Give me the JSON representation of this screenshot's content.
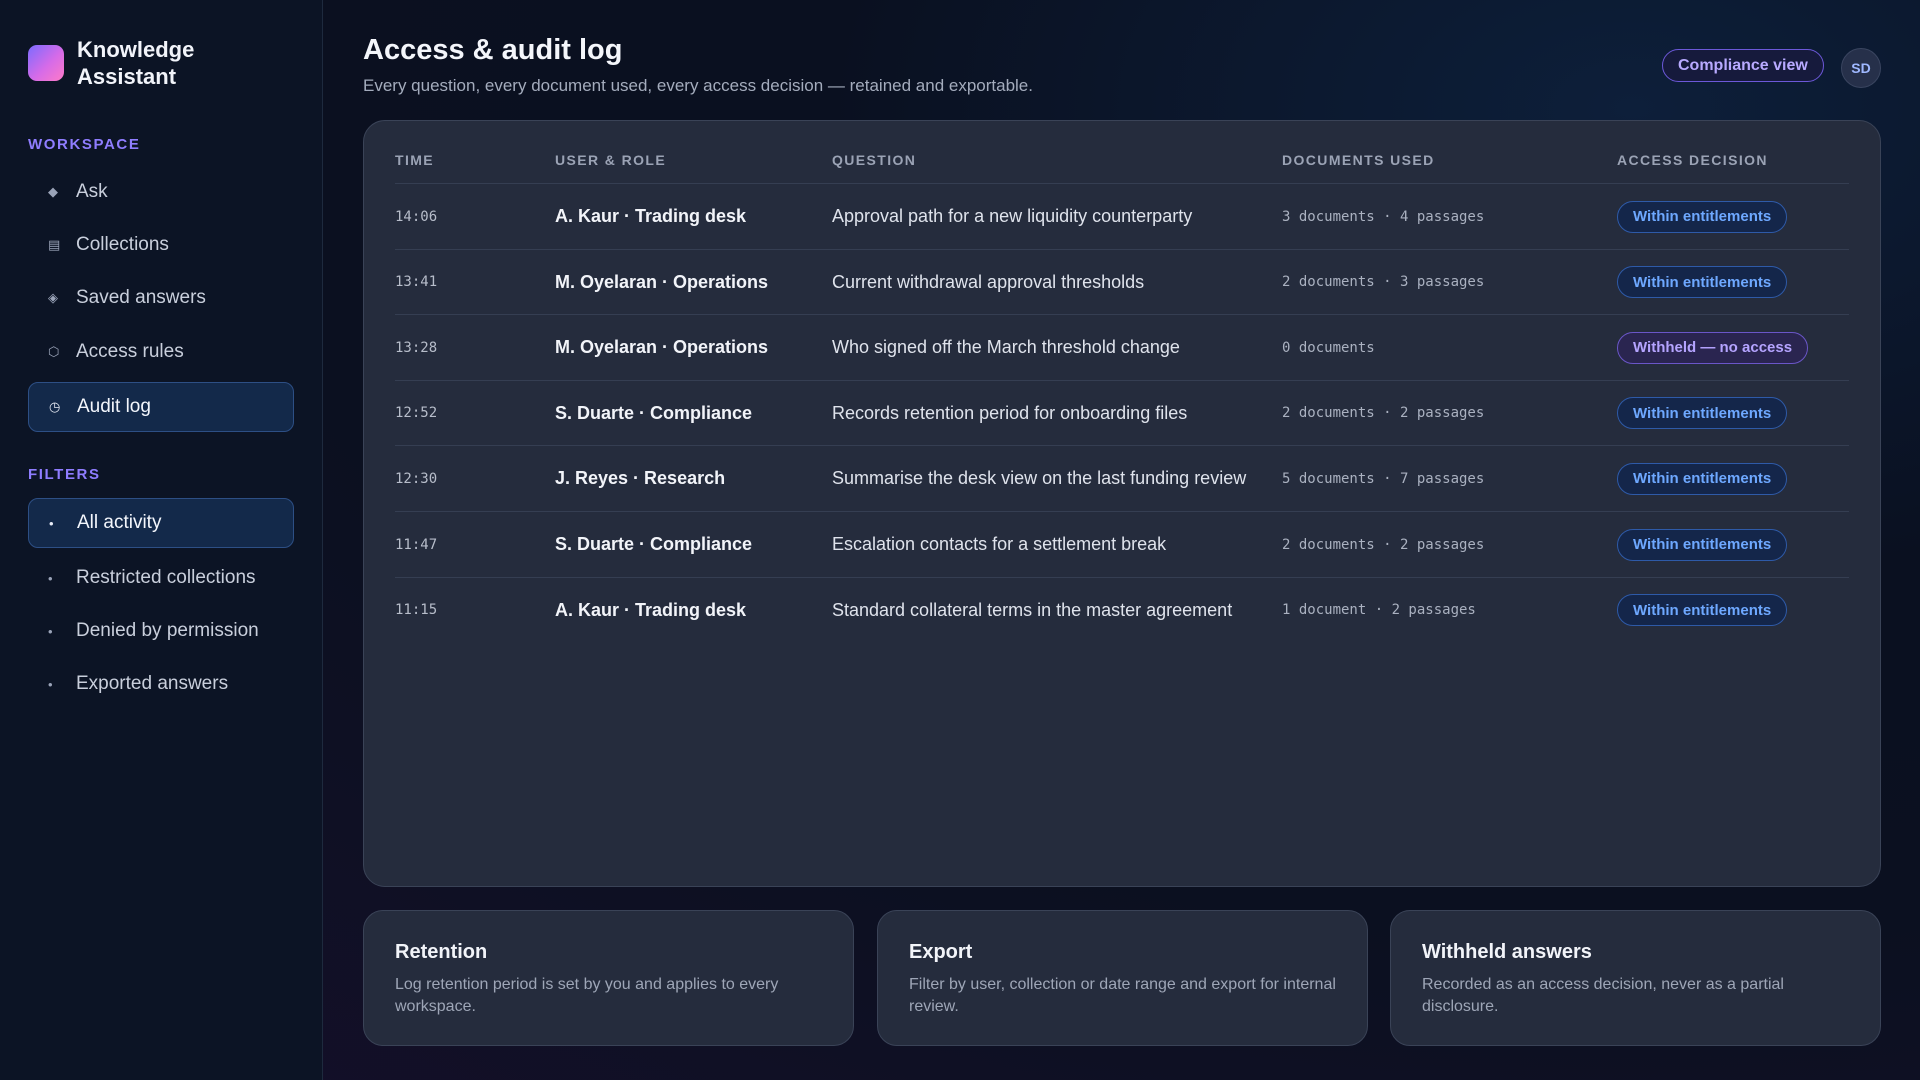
{
  "app": {
    "name": "Knowledge Assistant"
  },
  "sidebar": {
    "workspace_label": "WORKSPACE",
    "items": [
      {
        "label": "Ask",
        "icon": "diamond-icon"
      },
      {
        "label": "Collections",
        "icon": "list-icon"
      },
      {
        "label": "Saved answers",
        "icon": "bookmark-diamond-icon"
      },
      {
        "label": "Access rules",
        "icon": "shield-hexagon-icon"
      },
      {
        "label": "Audit log",
        "icon": "clock-icon",
        "active": true
      }
    ],
    "filters_label": "FILTERS",
    "filters": [
      {
        "label": "All activity",
        "active": true
      },
      {
        "label": "Restricted collections"
      },
      {
        "label": "Denied by permission"
      },
      {
        "label": "Exported answers"
      }
    ]
  },
  "header": {
    "title": "Access & audit log",
    "subtitle": "Every question, every document used, every access decision — retained and exportable.",
    "compliance_button": "Compliance view",
    "avatar_initials": "SD"
  },
  "table": {
    "columns": [
      "TIME",
      "USER & ROLE",
      "QUESTION",
      "DOCUMENTS USED",
      "ACCESS DECISION"
    ],
    "rows": [
      {
        "time": "14:06",
        "user": "A. Kaur · Trading desk",
        "question": "Approval path for a new liquidity counterparty",
        "docs": "3 documents · 4 passages",
        "access": "Within entitlements",
        "status": "ok"
      },
      {
        "time": "13:41",
        "user": "M. Oyelaran · Operations",
        "question": "Current withdrawal approval thresholds",
        "docs": "2 documents · 3 passages",
        "access": "Within entitlements",
        "status": "ok"
      },
      {
        "time": "13:28",
        "user": "M. Oyelaran · Operations",
        "question": "Who signed off the March threshold change",
        "docs": "0 documents",
        "access": "Withheld — no access",
        "status": "denied"
      },
      {
        "time": "12:52",
        "user": "S. Duarte · Compliance",
        "question": "Records retention period for onboarding files",
        "docs": "2 documents · 2 passages",
        "access": "Within entitlements",
        "status": "ok"
      },
      {
        "time": "12:30",
        "user": "J. Reyes · Research",
        "question": "Summarise the desk view on the last funding review",
        "docs": "5 documents · 7 passages",
        "access": "Within entitlements",
        "status": "ok"
      },
      {
        "time": "11:47",
        "user": "S. Duarte · Compliance",
        "question": "Escalation contacts for a settlement break",
        "docs": "2 documents · 2 passages",
        "access": "Within entitlements",
        "status": "ok"
      },
      {
        "time": "11:15",
        "user": "A. Kaur · Trading desk",
        "question": "Standard collateral terms in the master agreement",
        "docs": "1 document · 2 passages",
        "access": "Within entitlements",
        "status": "ok"
      }
    ]
  },
  "cards": [
    {
      "title": "Retention",
      "text": "Log retention period is set by you and applies to every workspace."
    },
    {
      "title": "Export",
      "text": "Filter by user, collection or date range and export for internal review."
    },
    {
      "title": "Withheld answers",
      "text": "Recorded as an access decision, never as a partial disclosure."
    }
  ],
  "colors": {
    "accent": "#8f7dff",
    "ok_badge": "#6ea8ff",
    "denied_badge": "#b5a4ff",
    "panel": "#252c3d"
  }
}
